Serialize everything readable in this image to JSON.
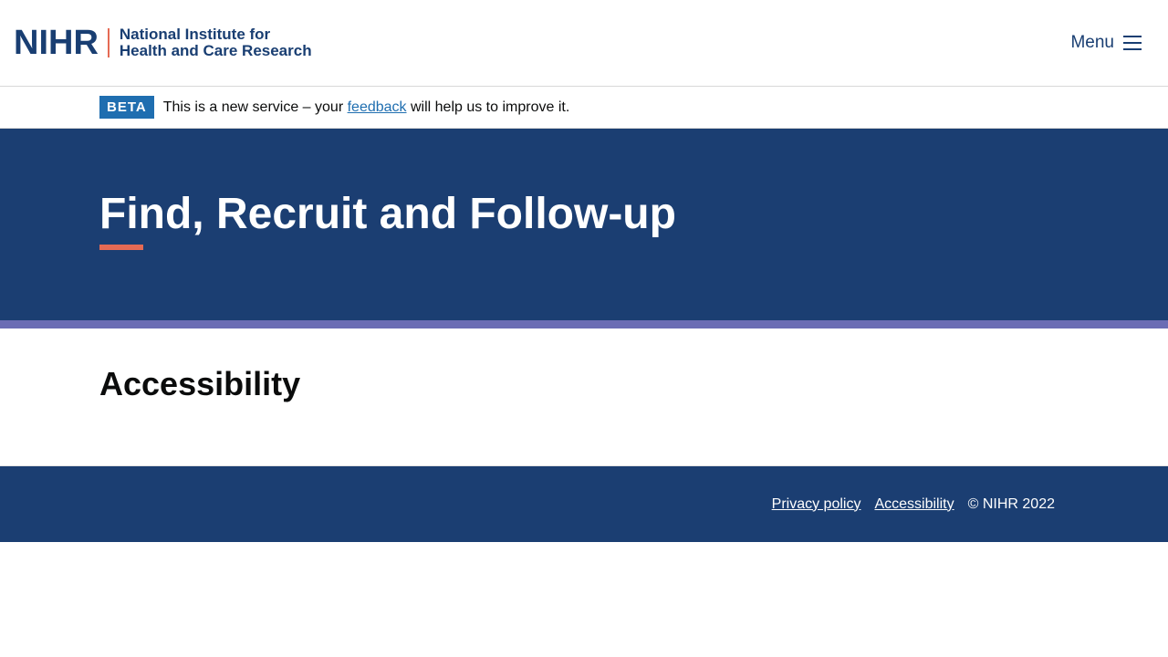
{
  "header": {
    "logo_mark": "NIHR",
    "logo_line1": "National Institute for",
    "logo_line2": "Health and Care Research",
    "menu_label": "Menu"
  },
  "beta_banner": {
    "tag": "BETA",
    "text_before": "This is a new service – your ",
    "link": "feedback",
    "text_after": " will help us to improve it."
  },
  "hero": {
    "title": "Find, Recruit and Follow-up"
  },
  "content": {
    "heading": "Accessibility"
  },
  "footer": {
    "links": [
      "Privacy policy",
      "Accessibility"
    ],
    "copyright": "© NIHR 2022"
  },
  "colors": {
    "brand_navy": "#1b3e72",
    "accent_coral": "#e56a54",
    "band_purple": "#6b6db4",
    "link_blue": "#1f6eb0"
  },
  "icons": [
    "hamburger-menu-icon"
  ]
}
